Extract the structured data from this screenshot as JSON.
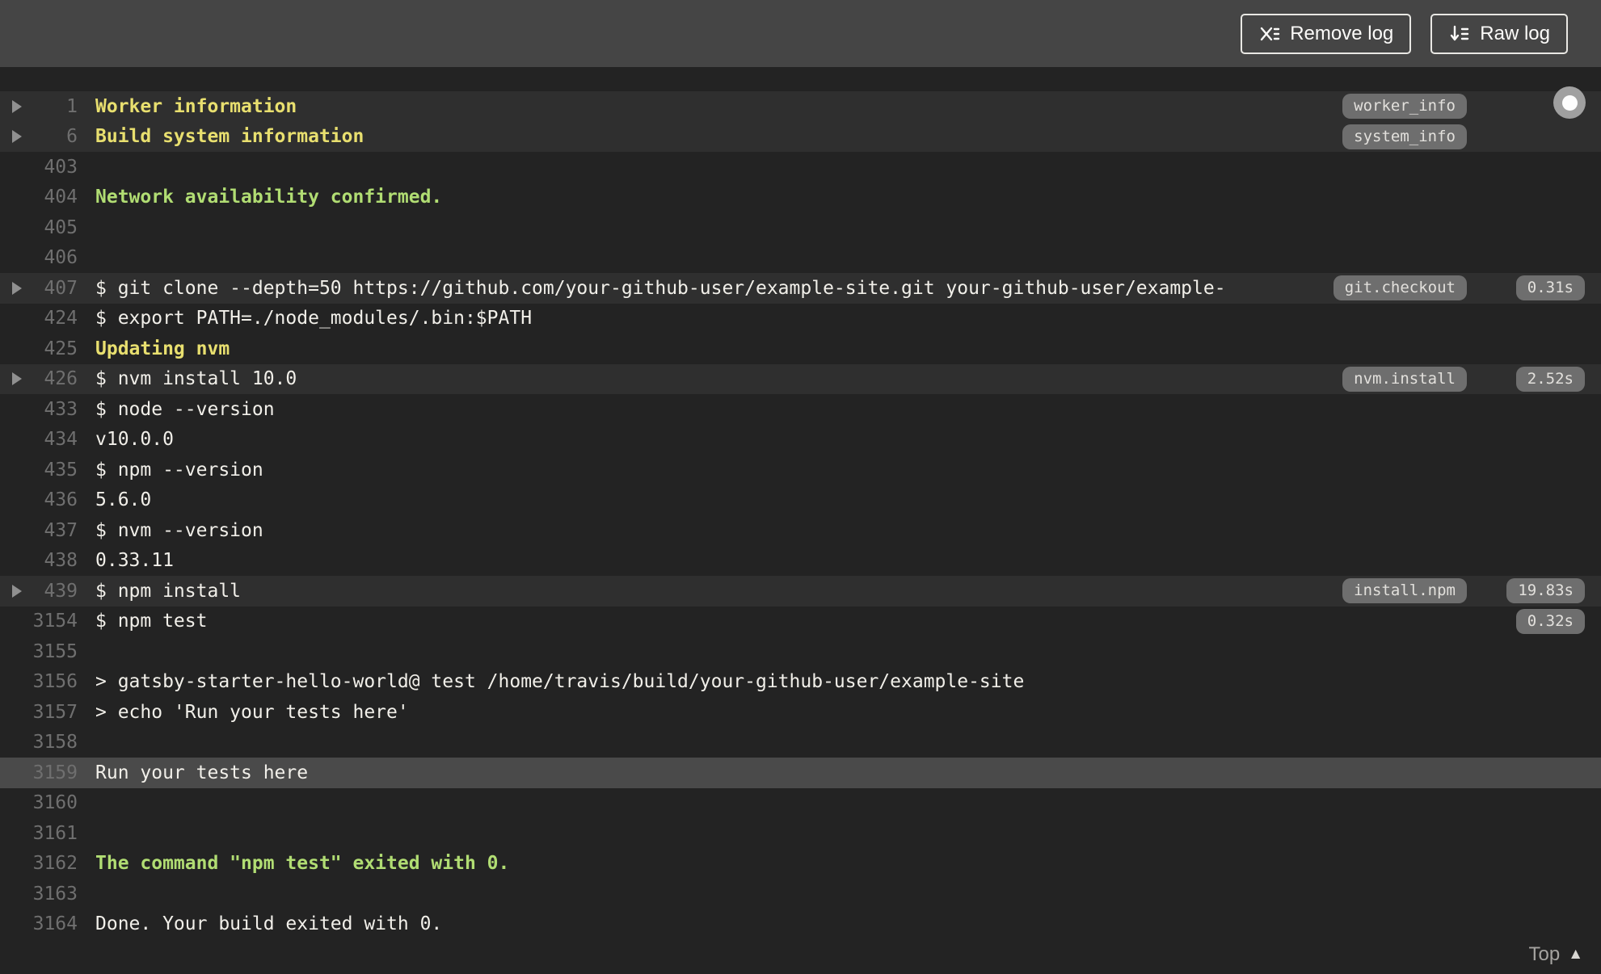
{
  "header": {
    "remove_log_label": "Remove log",
    "raw_log_label": "Raw log"
  },
  "footer": {
    "top_label": "Top"
  },
  "colors": {
    "topbar_bg": "#454545",
    "log_bg": "#232323",
    "fold_row_bg": "#2f2f2f",
    "highlight_row_bg": "#4a4a4a",
    "text": "#f1efe9",
    "fold_title_yellow": "#e8df6f",
    "success_green": "#b1dd73",
    "line_number_gray": "#6f6f6f",
    "pill_bg": "#6e6e6e"
  },
  "log": {
    "lines": [
      {
        "num": "1",
        "text": "Worker information",
        "style": "yellow",
        "fold": true,
        "arrow": true,
        "tag": "worker_info"
      },
      {
        "num": "6",
        "text": "Build system information",
        "style": "yellow",
        "fold": true,
        "arrow": true,
        "tag": "system_info"
      },
      {
        "num": "403",
        "text": ""
      },
      {
        "num": "404",
        "text": "Network availability confirmed.",
        "style": "green"
      },
      {
        "num": "405",
        "text": ""
      },
      {
        "num": "406",
        "text": ""
      },
      {
        "num": "407",
        "text": "$ git clone --depth=50 https://github.com/your-github-user/example-site.git your-github-user/example-",
        "fold": true,
        "arrow": true,
        "tag": "git.checkout",
        "duration": "0.31s"
      },
      {
        "num": "424",
        "text": "$ export PATH=./node_modules/.bin:$PATH"
      },
      {
        "num": "425",
        "text": "Updating nvm",
        "style": "yellow"
      },
      {
        "num": "426",
        "text": "$ nvm install 10.0",
        "fold": true,
        "arrow": true,
        "tag": "nvm.install",
        "duration": "2.52s"
      },
      {
        "num": "433",
        "text": "$ node --version"
      },
      {
        "num": "434",
        "text": "v10.0.0"
      },
      {
        "num": "435",
        "text": "$ npm --version"
      },
      {
        "num": "436",
        "text": "5.6.0"
      },
      {
        "num": "437",
        "text": "$ nvm --version"
      },
      {
        "num": "438",
        "text": "0.33.11"
      },
      {
        "num": "439",
        "text": "$ npm install",
        "fold": true,
        "arrow": true,
        "tag": "install.npm",
        "duration": "19.83s"
      },
      {
        "num": "3154",
        "text": "$ npm test",
        "duration": "0.32s"
      },
      {
        "num": "3155",
        "text": ""
      },
      {
        "num": "3156",
        "text": "> gatsby-starter-hello-world@ test /home/travis/build/your-github-user/example-site"
      },
      {
        "num": "3157",
        "text": "> echo 'Run your tests here'"
      },
      {
        "num": "3158",
        "text": ""
      },
      {
        "num": "3159",
        "text": "Run your tests here",
        "highlight": true
      },
      {
        "num": "3160",
        "text": ""
      },
      {
        "num": "3161",
        "text": ""
      },
      {
        "num": "3162",
        "text": "The command \"npm test\" exited with 0.",
        "style": "green"
      },
      {
        "num": "3163",
        "text": ""
      },
      {
        "num": "3164",
        "text": "Done. Your build exited with 0."
      }
    ]
  }
}
